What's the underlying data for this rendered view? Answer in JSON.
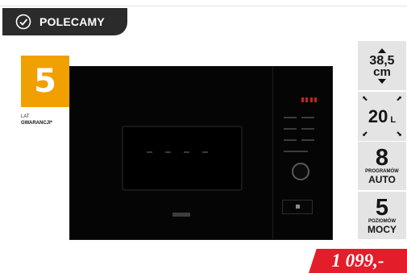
{
  "badge": {
    "label": "POLECAMY",
    "icon": "check-circle-icon"
  },
  "warranty": {
    "years": "5",
    "line1": "LAT",
    "line2": "GWARANCJI*",
    "color": "#f0a000"
  },
  "specs": {
    "height_value": "38,5",
    "height_unit": "cm",
    "capacity_value": "20",
    "capacity_unit": "L",
    "programs_value": "8",
    "programs_label": "PROGRAMÓW",
    "programs_sub": "AUTO",
    "power_value": "5",
    "power_label": "POZIOMÓW",
    "power_sub": "MOCY"
  },
  "price": {
    "text": "1 099,-",
    "color": "#e41d2a"
  },
  "product": {
    "image": "built-in-microwave-oven-black"
  }
}
